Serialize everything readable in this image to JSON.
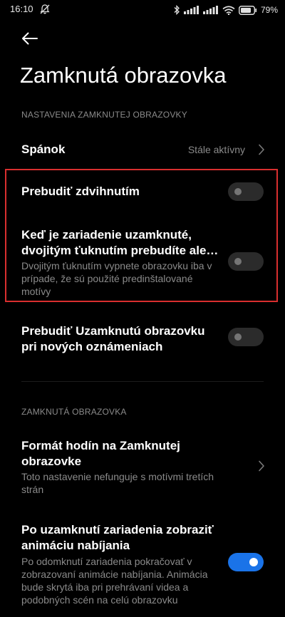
{
  "status_bar": {
    "time": "16:10",
    "left_icon": "notifications-muted-icon",
    "right_icons": [
      "bluetooth-icon",
      "signal-icon",
      "signal-icon",
      "wifi-icon",
      "battery-icon"
    ],
    "battery_percent": "79"
  },
  "header": {
    "back_icon": "back-arrow-icon",
    "title": "Zamknutá obrazovka"
  },
  "sections": [
    {
      "header": "NASTAVENIA ZAMKNUTEJ OBRAZOVKY",
      "items": [
        {
          "title": "Spánok",
          "value": "Stále aktívny",
          "control": "chevron-right-icon"
        },
        {
          "title": "Prebudiť zdvihnutím",
          "control": "toggle",
          "checked": false
        },
        {
          "title_line1": "Keď je zariadenie uzamknuté,",
          "title_line2": "dvojitým ťuknutím prebudíte ale…",
          "subtitle": "Dvojitým ťuknutím vypnete obrazovku iba v prípade, že sú použité predinštalované motívy",
          "control": "toggle",
          "checked": false
        },
        {
          "title_line1": "Prebudiť Uzamknutú obrazovku",
          "title_line2": "pri nových oznámeniach",
          "control": "toggle",
          "checked": false
        }
      ]
    },
    {
      "header": "ZAMKNUTÁ OBRAZOVKA",
      "items": [
        {
          "title_line1": "Formát hodín na Zamknutej",
          "title_line2": "obrazovke",
          "subtitle": "Toto nastavenie nefunguje s motívmi tretích strán",
          "control": "chevron-right-icon"
        },
        {
          "title_line1": "Po uzamknutí zariadenia zobraziť",
          "title_line2": "animáciu nabíjania",
          "subtitle": "Po odomknutí zariadenia pokračovať v zobrazovaní animácie nabíjania. Animácia bude skrytá iba pri prehrávaní videa a podobných scén na celú obrazovku",
          "control": "toggle",
          "checked": true
        }
      ]
    }
  ],
  "colors": {
    "background": "#000000",
    "highlight_border": "#d92f2f",
    "toggle_on": "#1a73e8",
    "toggle_off": "#2b2b2b",
    "secondary_text": "#8a8a8a"
  }
}
